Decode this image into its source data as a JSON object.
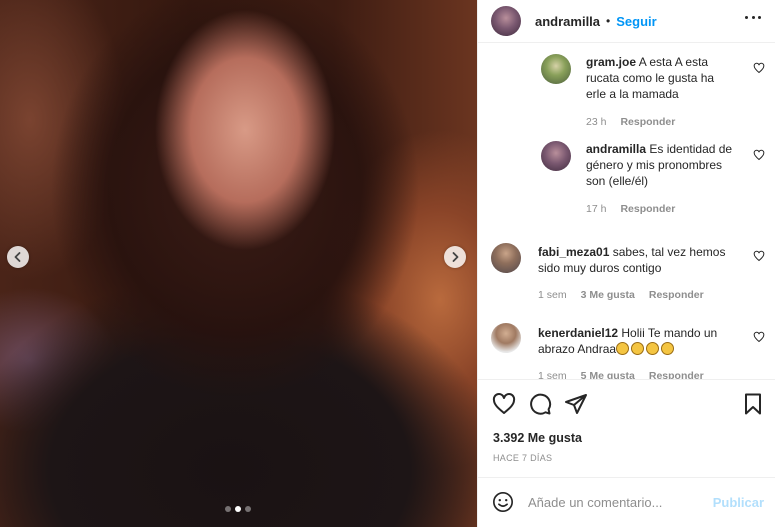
{
  "header": {
    "username": "andramilla",
    "separator": "•",
    "follow_label": "Seguir"
  },
  "comments": [
    {
      "username": "gram.joe",
      "line1": "A esta A esta",
      "line2": "rucata como le gusta ha",
      "line3": "erle a la mamada",
      "time": "23 h",
      "reply_label": "Responder"
    },
    {
      "username": "andramilla",
      "line1": "Es identidad de",
      "line2": "género y mis pronombres",
      "line3": "son (elle/él)",
      "time": "17 h",
      "reply_label": "Responder"
    },
    {
      "username": "fabi_meza01",
      "line1": "sabes, tal vez hemos",
      "line2": "sido muy duros contigo",
      "time": "1 sem",
      "likes": "3 Me gusta",
      "reply_label": "Responder"
    },
    {
      "username": "kenerdaniel12",
      "line1": "Holii Te mando un",
      "line2": "abrazo Andraa",
      "time": "1 sem",
      "likes": "5 Me gusta",
      "reply_label": "Responder"
    }
  ],
  "post": {
    "likes": "3.392 Me gusta",
    "ago": "HACE 7 DÍAS"
  },
  "add_comment": {
    "placeholder": "Añade un comentario...",
    "post_label": "Publicar"
  },
  "carousel": {
    "count": 3,
    "active": 2
  },
  "colors": {
    "accent": "#0095f6",
    "muted": "#8e8e8e",
    "post_disabled": "#b2dffc"
  }
}
